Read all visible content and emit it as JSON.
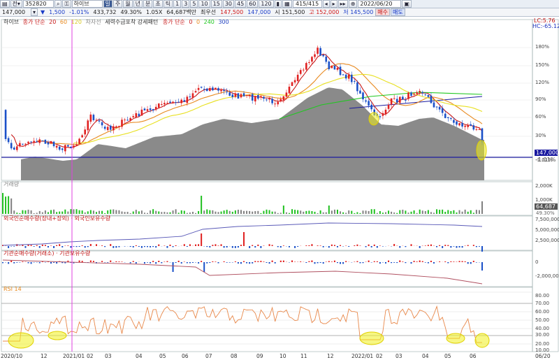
{
  "toolbar1": {
    "code": "352820",
    "stock_name": "하이브",
    "period_buttons": [
      "주",
      "월",
      "년",
      "분",
      "초",
      "틱"
    ],
    "interval_buttons": [
      "1",
      "3",
      "5",
      "10",
      "15",
      "30",
      "45",
      "60",
      "120"
    ],
    "count": "415/415",
    "date": "2022/06/20"
  },
  "toolbar2": {
    "price": "147,000",
    "change": "1,500",
    "change_pct": "-1.01%",
    "volume": "433,732",
    "ratio": "49.30%",
    "pct2": "1.05X",
    "amount": "64,687백만",
    "bidask": "최우선",
    "best_ask": "147,500",
    "best_bid": "147,000",
    "open": "시 151,500",
    "high": "고 152,000",
    "low": "저 145,500",
    "buy_label": "매수",
    "sell_label": "매도"
  },
  "legend_price": {
    "name": "하이브",
    "ma_label": "종가 단순",
    "periods": [
      "20",
      "60",
      "120"
    ],
    "extra": "차자선",
    "pattern": "세력수급포착 강세패턴",
    "ma2_label": "종가 단순",
    "periods2": [
      "0",
      "0",
      "240",
      "300"
    ]
  },
  "legend_volume": "거래량",
  "legend_foreign": "외국인순매수량(장내+장외) · 외국인보유수량",
  "legend_inst": "기관순매수량(거래소) · 기관보유수량",
  "legend_rsi": "RSI 14",
  "price_badge": "147,000",
  "price_badge_pct": "-1.01%",
  "lc_label": "LC:5.76",
  "hc_label": "HC:-65.12",
  "volume_badge": "64,687",
  "volume_badge_pct": "49.30%",
  "price_axis": [
    "180%",
    "150%",
    "120%",
    "90%",
    "60%",
    "30%",
    "-1.01%"
  ],
  "volume_axis": [
    "2,000K",
    "1,000K"
  ],
  "foreign_axis": [
    "7,500,000",
    "5,000,000",
    "2,500,000"
  ],
  "inst_axis": [
    "0",
    "-2,000,000"
  ],
  "rsi_axis": [
    "80.00",
    "70.00",
    "60.00",
    "50.00",
    "40.00",
    "30.00",
    "20.00",
    "10.00"
  ],
  "x_labels": [
    "2020/10",
    "12",
    "2021/01",
    "02",
    "03",
    "04",
    "05",
    "06",
    "07",
    "08",
    "09",
    "10",
    "11",
    "12",
    "2022/01",
    "02",
    "03",
    "04",
    "05",
    "06",
    "06/20"
  ],
  "colors": {
    "up": "#e02020",
    "down": "#1a50c8",
    "ma20": "#c81818",
    "ma60": "#e88a20",
    "ma120": "#e8e020",
    "ma240": "#20c820",
    "area": "#8a8a8a",
    "rsi": "#e8884a",
    "hline": "#1a1aa0",
    "vline": "#e040e0",
    "highlight": "#f0f020",
    "foreign_hold": "#5a5ab8",
    "inst_hold": "#b05060"
  }
}
